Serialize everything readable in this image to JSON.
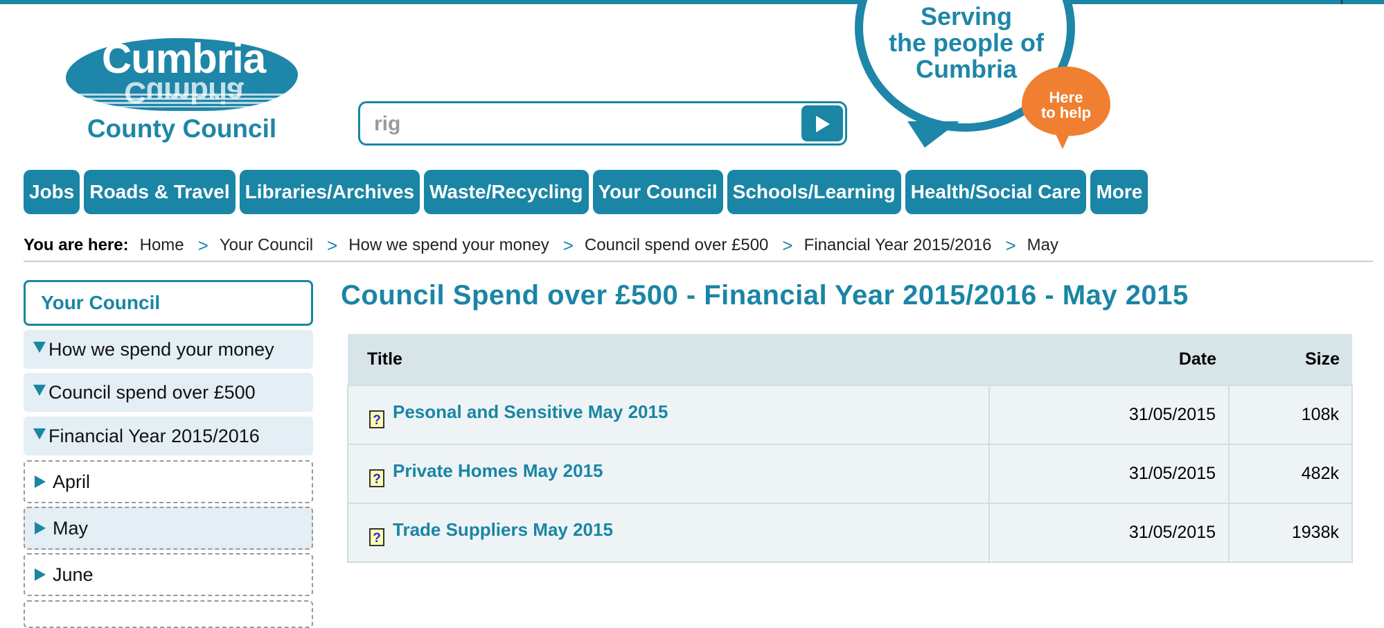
{
  "logo": {
    "word": "Cumbria",
    "reflection": "Cumbria",
    "subtitle": "County Council"
  },
  "search": {
    "value": "rig"
  },
  "bubble": {
    "line1": "Serving",
    "line2": "the people of",
    "line3": "Cumbria",
    "help_line1": "Here",
    "help_line2": "to help"
  },
  "nav": {
    "items": [
      {
        "label": "Jobs"
      },
      {
        "label": "Roads & Travel"
      },
      {
        "label": "Libraries/Archives"
      },
      {
        "label": "Waste/Recycling"
      },
      {
        "label": "Your Council"
      },
      {
        "label": "Schools/Learning"
      },
      {
        "label": "Health/Social Care"
      },
      {
        "label": "More"
      }
    ]
  },
  "breadcrumb": {
    "lead": "You are here:",
    "items": [
      "Home",
      "Your Council",
      "How we spend your money",
      "Council spend over £500",
      "Financial Year 2015/2016",
      "May"
    ],
    "separator": ">"
  },
  "sidebar": {
    "heading": "Your Council",
    "items": [
      {
        "label": "How we spend your money"
      },
      {
        "label": "Council spend over £500"
      },
      {
        "label": "Financial Year 2015/2016"
      },
      {
        "label": "April"
      },
      {
        "label": "May"
      },
      {
        "label": "June"
      }
    ]
  },
  "main": {
    "title": "Council Spend over £500 - Financial Year 2015/2016 - May 2015",
    "table": {
      "headers": [
        "Title",
        "Date",
        "Size"
      ],
      "rows": [
        {
          "title": "Pesonal and Sensitive May 2015",
          "date": "31/05/2015",
          "size": "108k"
        },
        {
          "title": "Private Homes May 2015",
          "date": "31/05/2015",
          "size": "482k"
        },
        {
          "title": "Trade Suppliers May 2015",
          "date": "31/05/2015",
          "size": "1938k"
        }
      ],
      "file_icon_glyph": "?"
    }
  },
  "colors": {
    "brand": "#1a85a5",
    "orange": "#f07f31",
    "header_bg": "#d7e4e8",
    "row_bg": "#eef4f6"
  },
  "icons": {
    "search_go": "play-arrow-icon",
    "menu_open": "triangle-down-icon",
    "menu_closed": "triangle-right-icon",
    "file": "unknown-file-icon"
  }
}
